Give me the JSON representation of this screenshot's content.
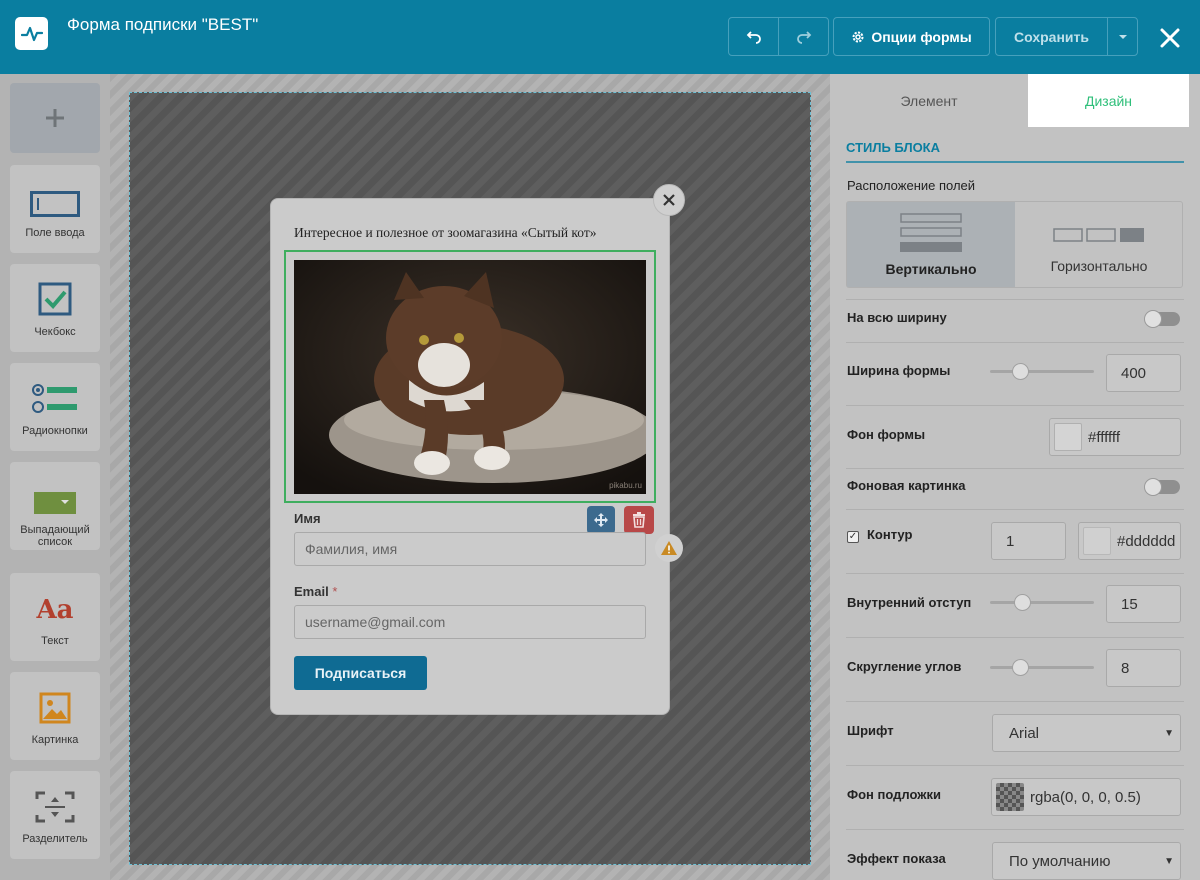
{
  "header": {
    "title": "Форма подписки \"BEST\"",
    "form_options_label": "Опции формы",
    "save_label": "Сохранить"
  },
  "sidebar": {
    "items": [
      {
        "label": "Поле ввода",
        "icon": "input-field-icon"
      },
      {
        "label": "Чекбокс",
        "icon": "checkbox-icon"
      },
      {
        "label": "Радиокнопки",
        "icon": "radio-buttons-icon"
      },
      {
        "label": "Выпадающий список",
        "icon": "dropdown-icon"
      },
      {
        "label": "Текст",
        "icon": "text-icon",
        "glyph": "Aa"
      },
      {
        "label": "Картинка",
        "icon": "image-icon"
      },
      {
        "label": "Разделитель",
        "icon": "separator-icon"
      }
    ]
  },
  "form": {
    "heading": "Интересное и полезное от зоомагазина «Сытый кот»",
    "image_watermark": "pikabu.ru",
    "name_label": "Имя",
    "name_placeholder": "Фамилия, имя",
    "email_label": "Email",
    "email_required_mark": "*",
    "email_placeholder": "username@gmail.com",
    "submit_label": "Подписаться"
  },
  "panel": {
    "tabs": [
      "Элемент",
      "Дизайн"
    ],
    "active_tab": "Дизайн",
    "section_title": "СТИЛЬ БЛОКА",
    "field_layout_label": "Расположение полей",
    "layout_vertical": "Вертикально",
    "layout_horizontal": "Горизонтально",
    "full_width_label": "На всю ширину",
    "form_width_label": "Ширина формы",
    "form_width_value": "400",
    "form_bg_label": "Фон формы",
    "form_bg_value": "#ffffff",
    "bg_image_label": "Фоновая картинка",
    "border_label": "Контур",
    "border_width_value": "1",
    "border_color_value": "#dddddd",
    "padding_label": "Внутренний отступ",
    "padding_value": "15",
    "radius_label": "Скругление углов",
    "radius_value": "8",
    "font_label": "Шрифт",
    "font_value": "Arial",
    "overlay_label": "Фон подложки",
    "overlay_value": "rgba(0, 0, 0, 0.5)",
    "effect_label": "Эффект показа",
    "effect_value": "По умолчанию"
  },
  "colors": {
    "topbar": "#0a7ea0",
    "accent_green": "#2fbf7a",
    "submit": "#0f6b93"
  }
}
